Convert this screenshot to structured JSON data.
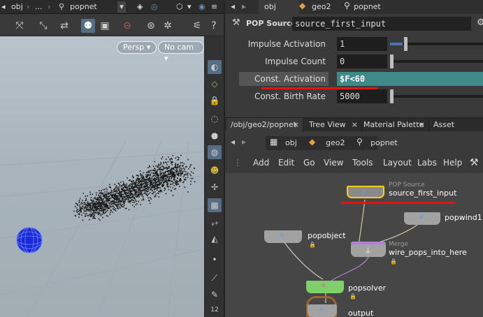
{
  "left_header": {
    "path_1": "obj",
    "sep": "...",
    "path_2": "popnet"
  },
  "left_toolbar": {
    "icons": [
      "transform-icon",
      "select-icon",
      "handle-icon",
      "viewer-icon",
      "display-icon",
      "record-icon",
      "camera-icon",
      "snapshot-icon",
      "settings-icon",
      "help-icon"
    ]
  },
  "viewport": {
    "perspective_label": "Persp",
    "camera_label": "No cam"
  },
  "parm_header": {
    "node_type": "POP Source",
    "node_name": "source_first_input"
  },
  "params": [
    {
      "label": "Impulse Activation",
      "value": "1"
    },
    {
      "label": "Impulse Count",
      "value": "0"
    },
    {
      "label": "Const. Activation",
      "value": "$F<60"
    },
    {
      "label": "Const. Birth Rate",
      "value": "5000"
    }
  ],
  "tabs": [
    {
      "label": "/obj/geo2/popnet"
    },
    {
      "label": "Tree View"
    },
    {
      "label": "Material Palette"
    },
    {
      "label": "Asset Browser"
    }
  ],
  "net_path": {
    "obj": "obj",
    "geo": "geo2",
    "net": "popnet"
  },
  "menus": [
    "Add",
    "Edit",
    "Go",
    "View",
    "Tools",
    "Layout",
    "Labs",
    "Help"
  ],
  "nodes": {
    "source": {
      "type_label": "POP Source",
      "name": "source_first_input"
    },
    "popwind": {
      "name": "popwind1"
    },
    "popobject": {
      "name": "popobject"
    },
    "merge": {
      "type_label": "Merge",
      "name": "wire_pops_into_here"
    },
    "popsolver": {
      "name": "popsolver"
    },
    "output": {
      "name": "output"
    }
  },
  "strip": {
    "frame_number": "12"
  },
  "colors": {
    "accent_blue": "#566e85",
    "highlight_field": "#3f8a88",
    "annotation_red": "#e01616",
    "solver_green": "#7fd06a",
    "merge_purple": "#b07fdc"
  }
}
